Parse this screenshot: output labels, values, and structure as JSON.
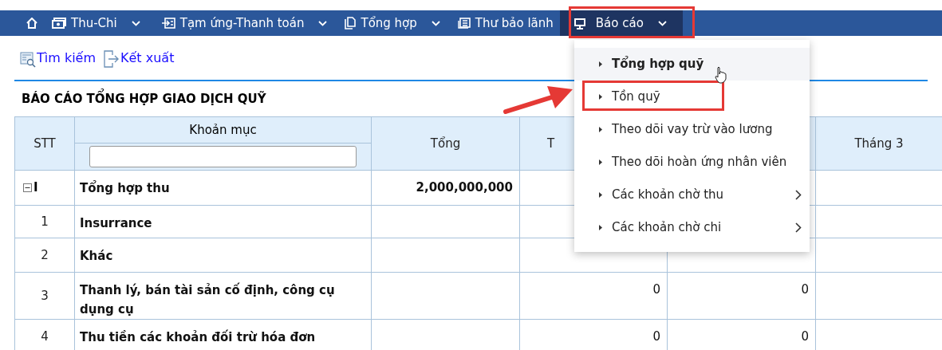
{
  "nav": {
    "items": [
      {
        "kind": "home"
      },
      {
        "kind": "menu",
        "label": "Thu-Chi",
        "dropdown": true,
        "selected": false
      },
      {
        "kind": "menu",
        "label": "Tạm ứng-Thanh toán",
        "dropdown": true,
        "selected": false
      },
      {
        "kind": "menu",
        "label": "Tổng hợp",
        "dropdown": true,
        "selected": false
      },
      {
        "kind": "menu",
        "label": "Thư bảo lãnh",
        "dropdown": false,
        "selected": false
      },
      {
        "kind": "menu",
        "label": "Báo cáo",
        "dropdown": true,
        "selected": true
      }
    ]
  },
  "toolbar": [
    {
      "label": "Tìm kiếm"
    },
    {
      "label": "Kết xuất"
    }
  ],
  "report": {
    "title": "BÁO CÁO TỔNG HỢP GIAO DỊCH QUỸ",
    "columns": [
      "STT",
      "Khoản mục",
      "Tổng",
      "T",
      "",
      "Tháng 3"
    ],
    "rows": [
      {
        "expanded": true,
        "cells": [
          "I",
          "Tổng hợp thu",
          "2,000,000,000",
          "",
          ""
        ]
      },
      {
        "cells": [
          "1",
          "Insurrance",
          "",
          "",
          ""
        ]
      },
      {
        "cells": [
          "2",
          "Khác",
          "",
          "",
          ""
        ]
      },
      {
        "cells": [
          "3",
          "Thanh lý, bán tài sản cố định, công cụ dụng cụ",
          "",
          "0",
          "0"
        ]
      },
      {
        "cells": [
          "4",
          "Thu tiền các khoản đối trừ hóa đơn",
          "",
          "0",
          "0"
        ]
      }
    ]
  },
  "dropdown_menu": {
    "items": [
      {
        "label": "Tổng hợp quỹ",
        "selected": true,
        "submenu": false
      },
      {
        "label": "Tồn quỹ",
        "selected": false,
        "submenu": false
      },
      {
        "label": "Theo dõi vay trừ vào lương",
        "selected": false,
        "submenu": false
      },
      {
        "label": "Theo dõi hoàn ứng nhân viên",
        "selected": false,
        "submenu": false
      },
      {
        "label": "Các khoản chờ thu",
        "selected": false,
        "submenu": true
      },
      {
        "label": "Các khoản chờ chi",
        "selected": false,
        "submenu": true
      }
    ]
  }
}
